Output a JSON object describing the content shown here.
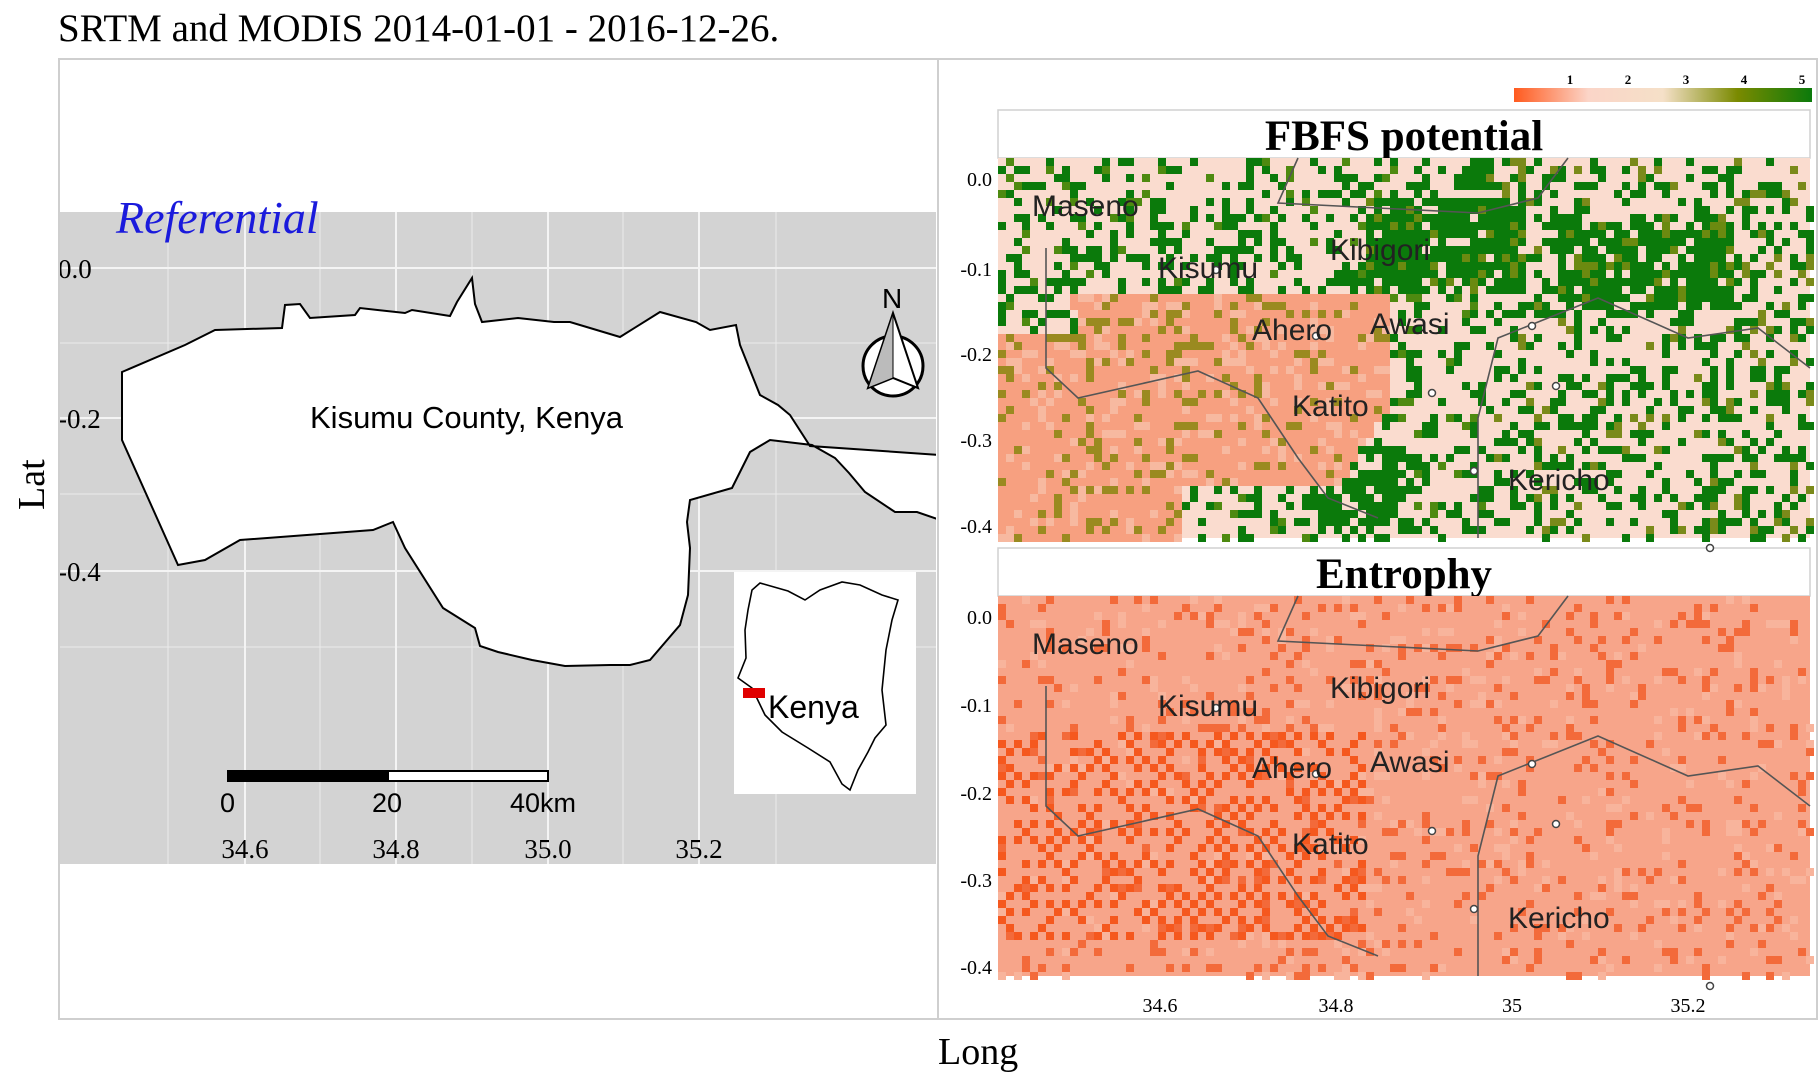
{
  "title": "SRTM and MODIS 2014-01-01 - 2016-12-26.",
  "axes": {
    "x_title": "Long",
    "y_title": "Lat"
  },
  "colors": {
    "panel_bg": "#d3d3d3",
    "grid": "#ebebeb",
    "referential_label": "#1a1adc",
    "fbfs_palette": [
      "#ff5a1e",
      "#fbd5c8",
      "#f5e0c8",
      "#7a8a00",
      "#0b7a0b"
    ],
    "entropy_base": "#f7a58a",
    "entropy_dark": "#f5581e",
    "city_marker": "#444444"
  },
  "referential_panel": {
    "label": "Referential",
    "region_label": "Kisumu County, Kenya",
    "y_ticks": [
      "0.0",
      "-0.2",
      "-0.4"
    ],
    "x_ticks": [
      "34.6",
      "34.8",
      "35.0",
      "35.2"
    ],
    "north_arrow_label": "N",
    "north_arrow_icon": "north-arrow-icon",
    "scalebar": {
      "labels": [
        "0",
        "20",
        "40km"
      ]
    },
    "inset": {
      "label": "Kenya"
    }
  },
  "legend": {
    "ticks": [
      "1",
      "2",
      "3",
      "4",
      "5"
    ]
  },
  "fbfs_panel": {
    "title": "FBFS potential",
    "y_ticks": [
      "0.0",
      "-0.1",
      "-0.2",
      "-0.3",
      "-0.4"
    ],
    "cities": [
      "Maseno",
      "Kisumu",
      "Kibigori",
      "Ahero",
      "Awasi",
      "Katito",
      "Kericho"
    ]
  },
  "entropy_panel": {
    "title": "Entrophy",
    "y_ticks": [
      "0.0",
      "-0.1",
      "-0.2",
      "-0.3",
      "-0.4"
    ],
    "x_ticks": [
      "34.6",
      "34.8",
      "35",
      "35.2"
    ],
    "cities": [
      "Maseno",
      "Kisumu",
      "Kibigori",
      "Ahero",
      "Awasi",
      "Katito",
      "Kericho"
    ]
  }
}
